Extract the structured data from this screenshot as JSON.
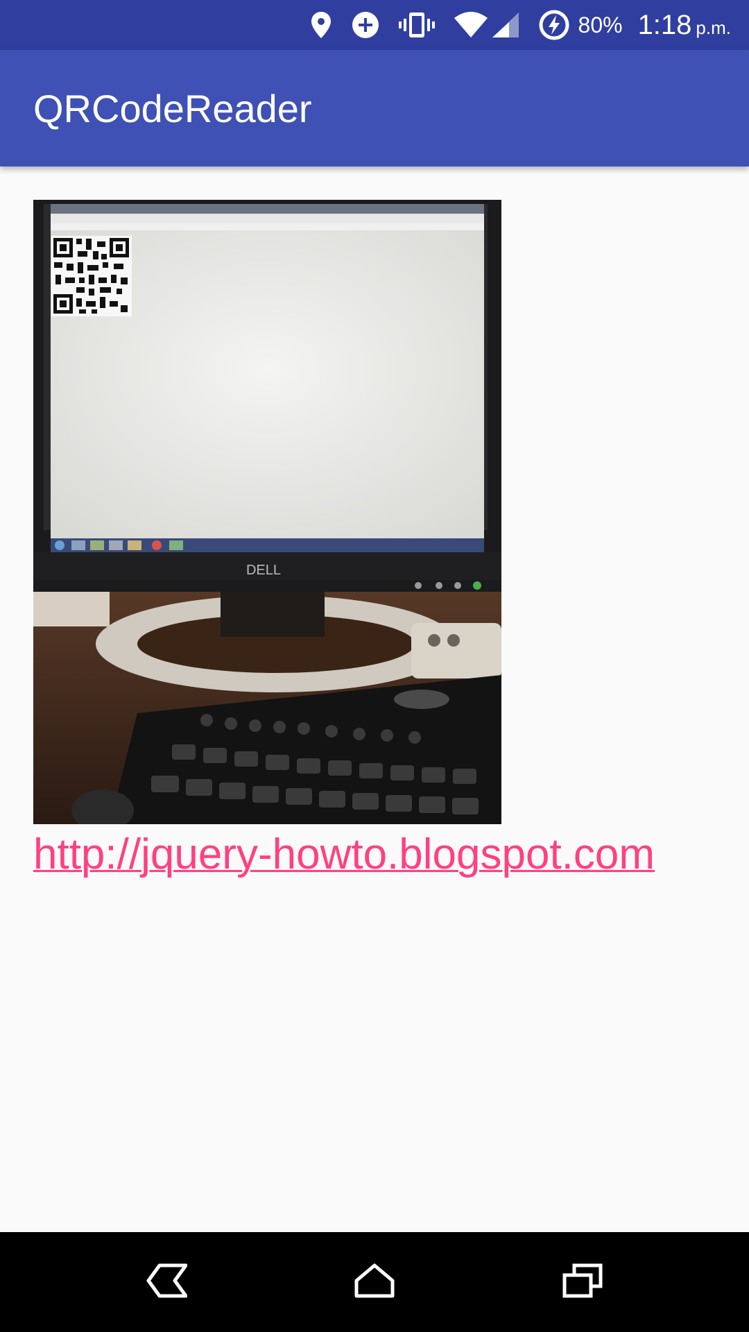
{
  "status_bar": {
    "icons": [
      "location-icon",
      "data-saver-icon",
      "vibrate-icon",
      "wifi-icon",
      "cell-signal-icon",
      "battery-charging-icon"
    ],
    "battery": "80%",
    "time": "1:18",
    "ampm": "p.m."
  },
  "app_bar": {
    "title": "QRCodeReader"
  },
  "main": {
    "captured_image": "photo-of-monitor-showing-qr-code",
    "monitor_brand": "DELL",
    "result_link": "http://jquery-howto.blogspot.com"
  },
  "nav_bar": {
    "buttons": [
      "back-icon",
      "home-icon",
      "recents-icon"
    ]
  },
  "colors": {
    "status_bar": "#303f9f",
    "app_bar": "#3f51b5",
    "accent": "#ff4081",
    "background": "#fafafa"
  }
}
